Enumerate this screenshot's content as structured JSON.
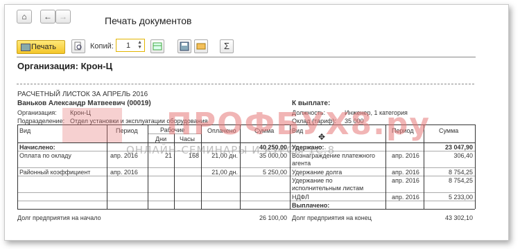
{
  "window": {
    "title": "Печать документов"
  },
  "toolbar": {
    "print_label": "Печать",
    "copies_label": "Копий:",
    "copies_value": "1"
  },
  "document": {
    "organization_heading": "Организация: Крон-Ц",
    "slip_title": "РАСЧЕТНЫЙ ЛИСТОК ЗА АПРЕЛЬ 2016",
    "employee": "Ваньков Александр Матвеевич (00019)",
    "org_label": "Организация:",
    "org_value": "Крон-Ц",
    "dept_label": "Подразделение:",
    "dept_value": "Отдел установки и эксплуатации оборудования",
    "payout_label": "К выплате:",
    "position_label": "Должность:",
    "position_value": "Инженер, 1 категория",
    "salary_label": "Оклад (тариф):",
    "salary_value": "35 000",
    "left_headers": {
      "vid": "Вид",
      "period": "Период",
      "work": "Рабочие",
      "days": "Дни",
      "hours": "Часы",
      "paid": "Оплачено",
      "sum": "Сумма"
    },
    "right_headers": {
      "vid": "Вид",
      "period": "Период",
      "sum": "Сумма"
    },
    "accrued_label": "Начислено:",
    "accrued_total": "40 250,00",
    "withheld_label": "Удержано:",
    "withheld_total": "23 047,90",
    "left_rows": [
      {
        "vid": "Оплата по окладу",
        "period": "апр. 2016",
        "days": "21",
        "hours": "168",
        "paid": "21,00 дн.",
        "sum": "35 000,00"
      },
      {
        "vid": "Районный коэффициент",
        "period": "апр. 2016",
        "days": "",
        "hours": "",
        "paid": "21,00 дн.",
        "sum": "5 250,00"
      }
    ],
    "right_rows": [
      {
        "vid1": "Вознаграждение платежного",
        "vid2": "агента",
        "period": "апр. 2016",
        "sum": "306,40"
      },
      {
        "vid1": "Удержание долга",
        "vid2": "",
        "period": "апр. 2016",
        "sum": "8 754,25"
      },
      {
        "vid1": "Удержание по",
        "vid2": "исполнительным листам",
        "period": "апр. 2016",
        "sum": "8 754,25"
      },
      {
        "vid1": "НДФЛ",
        "vid2": "",
        "period": "апр. 2016",
        "sum": "5 233,00"
      }
    ],
    "paid_out_label": "Выплачено:",
    "debt_start_label": "Долг предприятия на начало",
    "debt_start_value": "26 100,00",
    "debt_end_label": "Долг предприятия на конец",
    "debt_end_value": "43 302,10"
  },
  "watermark": {
    "main": "ПРОФБУХ8.ру",
    "sub": "ОНЛАЙН-СЕМИНАРЫ И КУРСЫ 1С:8"
  }
}
